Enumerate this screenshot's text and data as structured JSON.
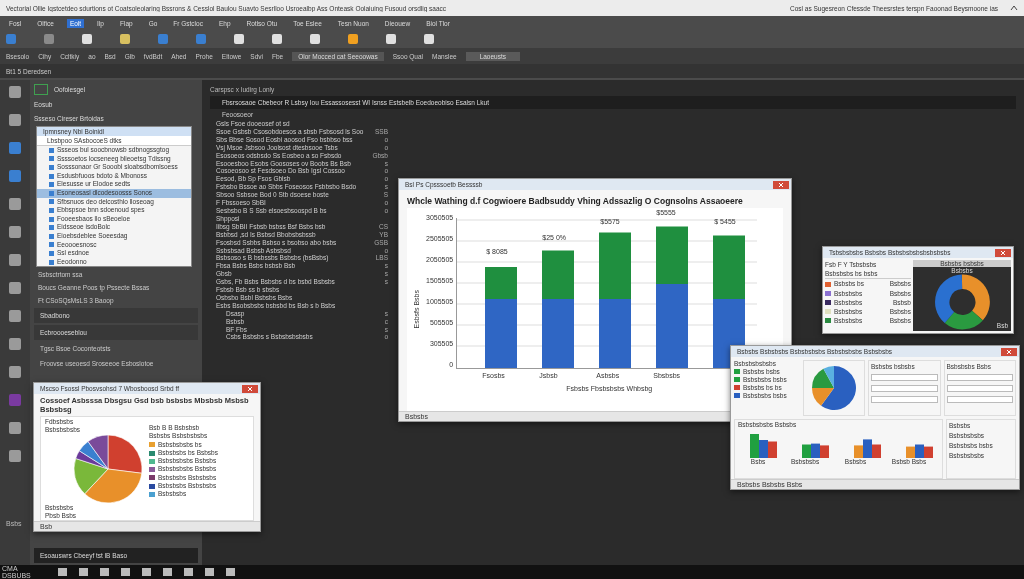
{
  "title_bar": {
    "title": "Vectorial Ollie Iqstcetdeo sdurtions ot Coatsoleolaring Bssrons & Cesslol Baulou Suavto Sesrlloo Usroealbp Ass Onteask Oolaiuing Fusoud orsdlig saacc",
    "right_text": "Cosl as Sugesreon Cfessde Theesrstes terspn Faoonad Beysmoone ias"
  },
  "menu": [
    {
      "label": "Fosl",
      "selected": false
    },
    {
      "label": "Olfice",
      "selected": false
    },
    {
      "label": "Eolt",
      "selected": true
    },
    {
      "label": "Ilp",
      "selected": false
    },
    {
      "label": "Flap",
      "selected": false
    },
    {
      "label": "Go",
      "selected": false
    },
    {
      "label": "Fr Gstcloc",
      "selected": false
    },
    {
      "label": "Ehp",
      "selected": false
    }
  ],
  "ribbon_labels": [
    "Rotlso Otu",
    "Toe Eslee",
    "Tesn Nuon",
    "Dieouew",
    "Biol Tlor"
  ],
  "ribbon_tools": [
    {
      "color": "#3a7fd0"
    },
    {
      "color": "#8a8a8a"
    },
    {
      "color": "#e0e0e0"
    },
    {
      "color": "#d8c060"
    },
    {
      "color": "#3a7fd0"
    },
    {
      "color": "#3a7fd0"
    },
    {
      "color": "#e0e0e0"
    },
    {
      "color": "#e0e0e0"
    },
    {
      "color": "#e0e0e0"
    },
    {
      "color": "#f0a020"
    },
    {
      "color": "#e0e0e0"
    },
    {
      "color": "#e0e0e0"
    }
  ],
  "formula_bar": {
    "items": [
      "Bsesolo",
      "Cihy",
      "Ccltkiy",
      "ao",
      "Bsd",
      "Glb",
      "fvdBdt",
      "Ahed",
      "Prohe",
      "Eltowe",
      "Sdvi",
      "Fbe"
    ],
    "cell_ref": "Olor Mocced cat Seeoowas",
    "field_value": "Ssoo Qual",
    "field_label": "Manslee",
    "field_right": "Laoeusts"
  },
  "tab_strip": {
    "label": "Bt1 5 Deredsen"
  },
  "sidebar": {
    "header": "Oofolesgel",
    "section": "Eosub",
    "filter": "Ssseso  Cireser Brtoidas",
    "dropdown": "Ipmnsney Nbi Boinidl",
    "subheader": "Lbsbpoo SAsbocoeS dtks",
    "items": [
      {
        "label": "Ssseos bul soocbnowsb sdbnogssgtog",
        "selected": false
      },
      {
        "label": "Ssssoetos locseneeg blieoetsg Tdissng",
        "selected": false
      },
      {
        "label": "Sosssonaor Gr Sooobl sloabsdbomlsoess",
        "selected": false
      },
      {
        "label": "Esdusbfuoos bdoto & Mbonoss",
        "selected": false
      },
      {
        "label": "Elesusse ur Elodoe sedts",
        "selected": false
      },
      {
        "label": "Esoneosasl dlcodesoosss Sonos",
        "selected": true
      },
      {
        "label": "Sfbsnuos deo delcosthlo lloseoag",
        "selected": false
      },
      {
        "label": "Ebbspsoe bnn sdoenoud spes",
        "selected": false
      },
      {
        "label": "Fooeesbaos llo sBeoeloe",
        "selected": false
      },
      {
        "label": "Eidsseoe isdoBolc",
        "selected": false
      },
      {
        "label": "Eioebsdeblee Soeesdag",
        "selected": false
      },
      {
        "label": "Eeoooesnosc",
        "selected": false
      },
      {
        "label": "Ssl esdnoe",
        "selected": false
      },
      {
        "label": "Eeodonno",
        "selected": false
      }
    ],
    "notes": [
      "Ssbsctrtom ssa",
      "Boucs Geanne Poos tp Pssecte Bssas",
      "Ft CSoSQsMsLS 3 Baoop"
    ],
    "panels": [
      {
        "label": "Sbadbono"
      },
      {
        "label": "Ecbroooeseblou"
      }
    ],
    "accounts": [
      {
        "label": "Tgsc  Bsoe Coconteotsts"
      },
      {
        "label": "Froovse useoesd Sroseeoe Esboslotoe"
      }
    ],
    "status_text": "Esoauswrs Cbeeyf tst lB Baso"
  },
  "editor": {
    "tab": "Carspsc x Iudirg Lonly",
    "heading": "Fbsrsosaoe  Cbebeor R Lsbsy  Iou  Essassosesst  WI  Isnss Estsbelb  Eoedoeobiso  Esalsn Lkut",
    "section": "Feoosoeor",
    "lines": [
      {
        "text": "Gsls Fsoe  dooeosef ot sd"
      },
      {
        "text": "Ssoe  Gsbsb  Csosobdoesos  a  sbsb  Fsbsosd  ls  Soo",
        "gutter": "SSB"
      },
      {
        "text": "Sbs  Bbse  Sosod  Eosbi  aoosod  Fso  bsbbso  bss",
        "gutter": "o"
      },
      {
        "text": "Vsj  Msoe  Jsbsoo  Joolsost  dtesbsooe  Tsbs",
        "gutter": "o"
      },
      {
        "text": "Esosoeos odsbsdo  Ss  Eosbeo  a  so  Fsbsdo",
        "gutter": "Gbsb"
      },
      {
        "text": "Esooesboo  Esobs  Goososes  ov  Boobs  Bs  Bsb",
        "gutter": "s"
      },
      {
        "text": "Cosoeosoo  st  Fesdsoeo  Do  Bsb  Igsl  Cossoo",
        "gutter": "o"
      },
      {
        "text": "Eesod,  Bb  Sp  Fsos  Gblsb",
        "gutter": "o"
      },
      {
        "text": "Fsbsbo  Bssoe  ao  Sbbs  Foseosos  Fsbbsbo  Bsdo",
        "gutter": "s"
      },
      {
        "text": "Sbsoo  Ssbsoe  Bod  0  Stb  dsoese  boste",
        "gutter": "S"
      },
      {
        "text": "F  Fbssoeso  SbBI",
        "gutter": "o"
      },
      {
        "text": "Sesbsbo  B  S  Ssb  elsoesbsoospd  B  bs",
        "gutter": "o"
      },
      {
        "text": "Shpposi"
      },
      {
        "text": "Iibsg  SbBII  Fsbsb  bsbss  Bsf  Bsbs  bsb",
        "gutter": "CS"
      },
      {
        "text": "Bsbbsd  ,sd  Is  Bsbsd  Bbobsbsbssb",
        "gutter": "YB"
      },
      {
        "text": "Fsosbsd  Ssbbs  Bsbso  s  bsobso  abo  bsbs",
        "gutter": "GSB"
      },
      {
        "text": "Ssbsbsad  Bsbsb  Asbsbsd",
        "gutter": "o"
      },
      {
        "text": "Bsbsoso  s  B  bsbssbs  Bsbsbs  (bsBsbs)",
        "gutter": "LBS"
      },
      {
        "text": "Fbsa  Bsbs  Bsbs  bsbsb  Bsb",
        "gutter": "s"
      },
      {
        "text": "Gbsb",
        "gutter": "s"
      },
      {
        "text": "Gsbs,  Fb  Bsbs  Bsbsbs  d  bs  bsbd  Bsbsbs",
        "gutter": "s"
      },
      {
        "text": "Fsbsb  Bsb  ss  b  sbsbs"
      },
      {
        "text": "Osbsbo  Bsbl  Bsbsbs  Bsbs"
      },
      {
        "text": "Esbs  Bsobsbsbs  bsbsbd  bs  Bsb  s  b  Bsbs"
      }
    ],
    "tree": [
      {
        "text": "Dsasp",
        "gutter": "s"
      },
      {
        "text": "Bsbsb",
        "gutter": "c"
      },
      {
        "text": "BF  Fbs",
        "gutter": "s"
      },
      {
        "text": "Csbs  Bsbsbs  s  Bsbsbsbsbsbs",
        "gutter": "o"
      }
    ]
  },
  "chart_window": {
    "title": "Bsl  Ps  Cpsssoetb  Bessssb",
    "chart_title": "Whcle Wathing d.f Cogwioere Badbsuddy Vhing Adssazlig O Cognsolns Assaoeere",
    "ylabel": "Esbsfs Bsbs",
    "yticks": [
      "3050505",
      "2505505",
      "2050505",
      "1505505",
      "1005505",
      "505505",
      "305505",
      "0"
    ],
    "data_labels": [
      "$ 8085",
      "$25 0%",
      "$5575",
      "$5555",
      "$ 5455"
    ],
    "xlabels": [
      "Fsosbs",
      "Jsbsb",
      "Asbsbs",
      "Sbsbsbs"
    ],
    "xlabel": "Fsbsbs  Fbsbsbsbs  Whbsbg",
    "status": "Bsbsbs"
  },
  "pie_window": {
    "title": "Mscso Fsossl Pbosvsohsd 7 Wbosboosd  Srbd ff",
    "chart_title": "Cossoef Asbsssa  Dbsgsu  Gsd bsb  bsbsbs Mbsbsb Msbsb Bsbsbsg",
    "callouts": [
      "Fdbsbsbs",
      "Bsbsbsbsbs",
      "Bsbsbsbs",
      "Pbsb  Bsbs"
    ],
    "legend_header": [
      "Bsb  B  B  Bsbsbsb",
      "Bsbsbs  Bsbsbsbsbs"
    ],
    "legend": [
      {
        "label": "Bsbsbsbsbs  bs",
        "color": "#e8a030"
      },
      {
        "label": "Bsbsbsbs  bs  Bsbsbs",
        "color": "#2a8a70"
      },
      {
        "label": "Bsbsbsbsbs  Bsbsbs",
        "color": "#50b890"
      },
      {
        "label": "Bsbsbsbsbs  Bsbsbs",
        "color": "#8a5a9a"
      },
      {
        "label": "Bsbsbsbs  Bsbsbsbs",
        "color": "#7a3a6a"
      },
      {
        "label": "Bsbsbsbs  Bsbsbsbs",
        "color": "#2a4aa0"
      },
      {
        "label": "Bsbsbsbs",
        "color": "#4aa0d0"
      }
    ],
    "footer": "Bsb",
    "side_note": "Bsbs"
  },
  "donut_window": {
    "title": "Tsbsbsbsbs  Bsbsbs  Bsbsbsbsbsbsbsbsbs",
    "toolbar": "Fsb  F  Y  Tsbsbsbs",
    "filters": [
      "Bsbsbsbs  bs  bsbs"
    ],
    "rows": [
      {
        "label": "Bsbsbs  bs",
        "value": "Bsbsbs",
        "color": "#e06030"
      },
      {
        "label": "Bsbsbsbs",
        "value": "Bsbsbs",
        "color": "#8a70d0"
      },
      {
        "label": "Bsbsbsbs",
        "value": "Bsbsb",
        "color": "#3a2a60"
      },
      {
        "label": "Bsbsbsbs",
        "value": "Bsbsbs",
        "color": "#e0e0c0"
      },
      {
        "label": "Bsbsbsbs",
        "value": "Bsbsbs",
        "color": "#2a8a40"
      }
    ],
    "panel_title": "Bsbsbs  bsbsbs",
    "chart_label": "Bsbsbs",
    "corner_label": "Bsb"
  },
  "dashboard_window": {
    "title": "Bsbsbs  Bsbsbsbs  Bsbsbsbsbs  Bsbsbsbsbs  Bsbsbsbs",
    "legend_title": "Bsbsbsbsbsbs",
    "legend": [
      {
        "label": "Bsbsbs  bsbs",
        "color": "#20a040"
      },
      {
        "label": "Bsbsbsbs  bsbs",
        "color": "#20a040"
      },
      {
        "label": "Bsbsbs  bs  bs",
        "color": "#d04030"
      },
      {
        "label": "Bsbsbsbs  bsbs",
        "color": "#2a60c0"
      }
    ],
    "panel_titles": [
      "Bsbsbs  bsbsbs",
      "Bsbsbsbs  Bsbs"
    ],
    "bars_title": "Bsbsbsbsbs  Bsbsbs",
    "bar_labels": [
      "Bsbs",
      "Bsbsbsbs",
      "Bsbsbs",
      "Bsbsb  Bsbs"
    ],
    "side_items": [
      "Bsbsbs",
      "Bsbsbsbsbs",
      "Bsbsbsbs  bsbs",
      "Bsbsbsbsbs"
    ],
    "status": "Bsbsbs  Bsbsbs  Bsbs"
  },
  "taskbar": {
    "start_text": "CMA DSBUBS"
  }
}
